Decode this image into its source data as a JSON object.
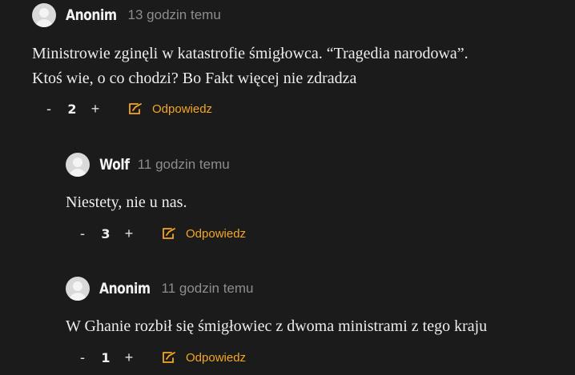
{
  "comments": [
    {
      "author": "Anonim",
      "time": "13 godzin temu",
      "lines": [
        "Ministrowie zginęli w katastrofie śmigłowca. “Tragedia narodowa”.",
        "Ktoś wie, o co chodzi? Bo Fakt więcej nie zdradza"
      ],
      "minus": "-",
      "votes": "2",
      "plus": "+",
      "reply_label": "Odpowiedz"
    },
    {
      "author": "Wolf",
      "time": "11 godzin temu",
      "lines": [
        "Niestety, nie u nas."
      ],
      "minus": "-",
      "votes": "3",
      "plus": "+",
      "reply_label": "Odpowiedz"
    },
    {
      "author": "Anonim",
      "time": "11 godzin temu",
      "lines": [
        "W Ghanie rozbił się śmigłowiec z dwoma ministrami z tego kraju"
      ],
      "minus": "-",
      "votes": "1",
      "plus": "+",
      "reply_label": "Odpowiedz"
    }
  ],
  "colors": {
    "background": "#1b1b1b",
    "accent": "#f5a623",
    "muted": "#8d8d8d"
  },
  "icons": {
    "avatar": "user-avatar-icon",
    "reply": "reply-icon"
  }
}
